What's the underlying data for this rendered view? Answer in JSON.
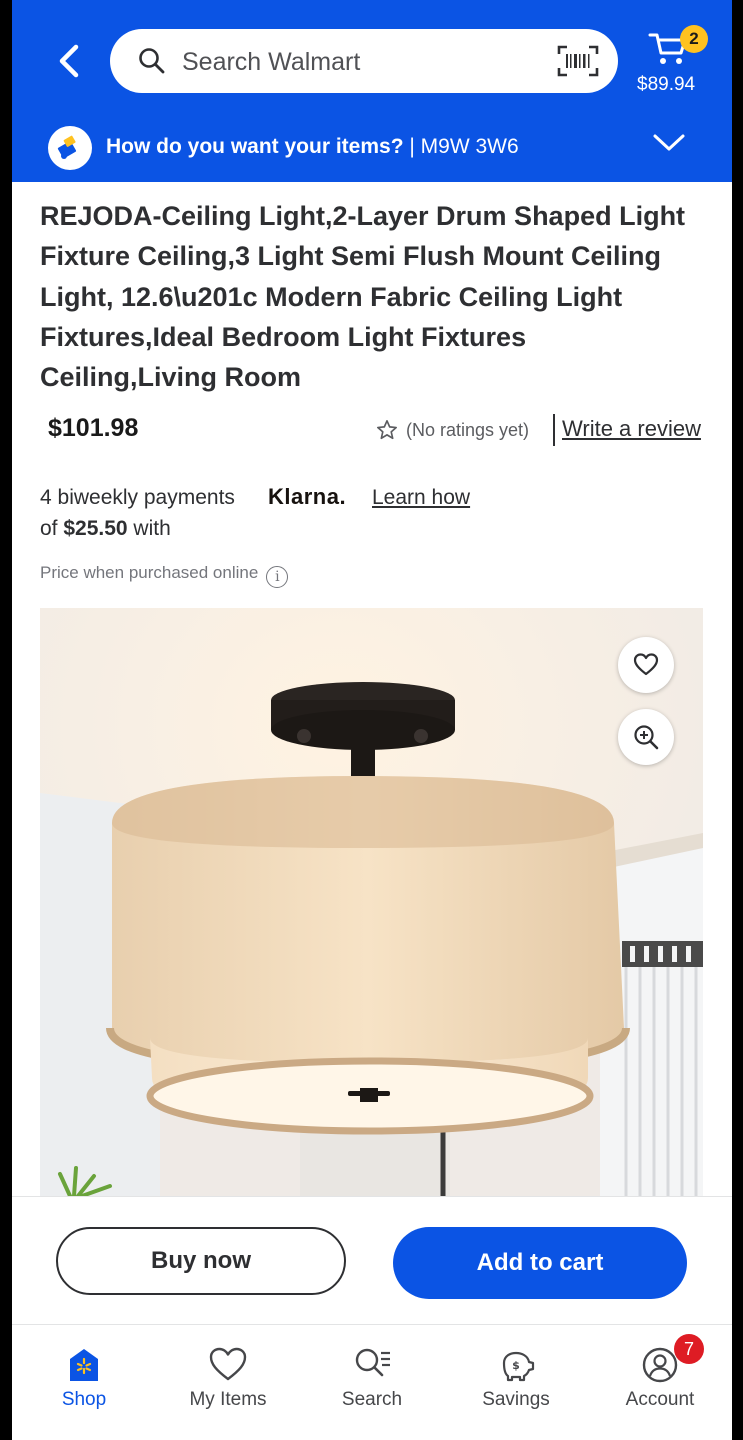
{
  "header": {
    "search_placeholder": "Search Walmart",
    "cart_count": "2",
    "cart_total": "$89.94",
    "delivery_question": "How do you want your items?",
    "delivery_postal": "| M9W 3W6"
  },
  "product": {
    "title": "REJODA-Ceiling Light,2-Layer Drum Shaped Light Fixture Ceiling,3 Light Semi Flush Mount Ceiling Light, 12.6\\u201c Modern Fabric Ceiling Light Fixtures,Ideal Bedroom Light Fixtures Ceiling,Living Room",
    "price": "$101.98",
    "ratings_text": "(No ratings yet)",
    "write_review": "Write a review",
    "klarna_line1": "4 biweekly payments",
    "klarna_line2_prefix": "of ",
    "klarna_amount": "$25.50",
    "klarna_line2_suffix": " with",
    "klarna_logo": "Klarna.",
    "learn_how": "Learn how",
    "price_note": "Price when purchased online",
    "info_glyph": "i"
  },
  "actions": {
    "buy_now": "Buy now",
    "add_to_cart": "Add to cart"
  },
  "tabs": [
    {
      "label": "Shop",
      "icon": "shop-icon",
      "active": true
    },
    {
      "label": "My Items",
      "icon": "heart-icon"
    },
    {
      "label": "Search",
      "icon": "search-list-icon"
    },
    {
      "label": "Savings",
      "icon": "piggy-bank-icon"
    },
    {
      "label": "Account",
      "icon": "account-icon"
    }
  ],
  "account_badge": "7",
  "colors": {
    "brand_blue": "#0b54e4",
    "cart_badge": "#ffc220",
    "alert_badge": "#de1c24"
  }
}
